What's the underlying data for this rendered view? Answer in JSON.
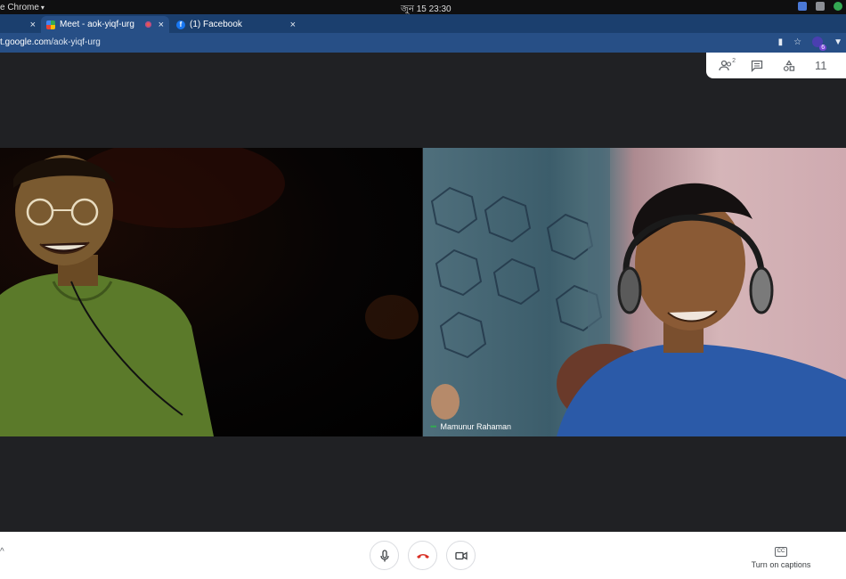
{
  "os": {
    "app_menu": "e Chrome",
    "clock": "জুন 15  23:30"
  },
  "tabs": [
    {
      "label": "",
      "close": "×"
    },
    {
      "label": "Meet - aok-yiqf-urg",
      "close": "×"
    },
    {
      "label": "(1) Facebook",
      "close": "×"
    }
  ],
  "new_tab": "+",
  "address": {
    "url_host": "t.google.com",
    "url_path": "/aok-yiqf-urg"
  },
  "meet": {
    "participant_count_badge": "2",
    "panel_overflow_text": "11",
    "participants": [
      {
        "name": ""
      },
      {
        "name": "Mamunur Rahaman"
      }
    ],
    "captions_label": "Turn on captions",
    "captions_icon_text": "CC"
  },
  "colors": {
    "tabstrip": "#1b3f6e",
    "active_tab": "#274f86",
    "meet_bg": "#202124",
    "hangup": "#d93025",
    "speaking": "#34a853"
  }
}
